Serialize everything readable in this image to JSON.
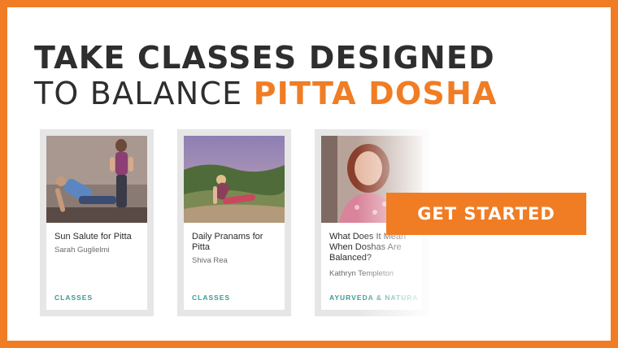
{
  "headline": {
    "line1": "TAKE CLASSES DESIGNED",
    "line2_plain": "TO BALANCE ",
    "line2_accent": "PITTA DOSHA"
  },
  "cards": [
    {
      "title": "Sun Salute for Pitta",
      "author": "Sarah Guglielmi",
      "tag": "CLASSES"
    },
    {
      "title": "Daily Pranams for Pitta",
      "author": "Shiva Rea",
      "tag": "CLASSES"
    },
    {
      "title": "What Does It Mean When Doshas Are Balanced?",
      "author": "Kathryn Templeton",
      "tag": "AYURVEDA & NATURA"
    }
  ],
  "cta": {
    "label": "GET STARTED"
  },
  "colors": {
    "accent": "#f07d24",
    "tag": "#3a9a93",
    "headline": "#2e2e2e"
  }
}
